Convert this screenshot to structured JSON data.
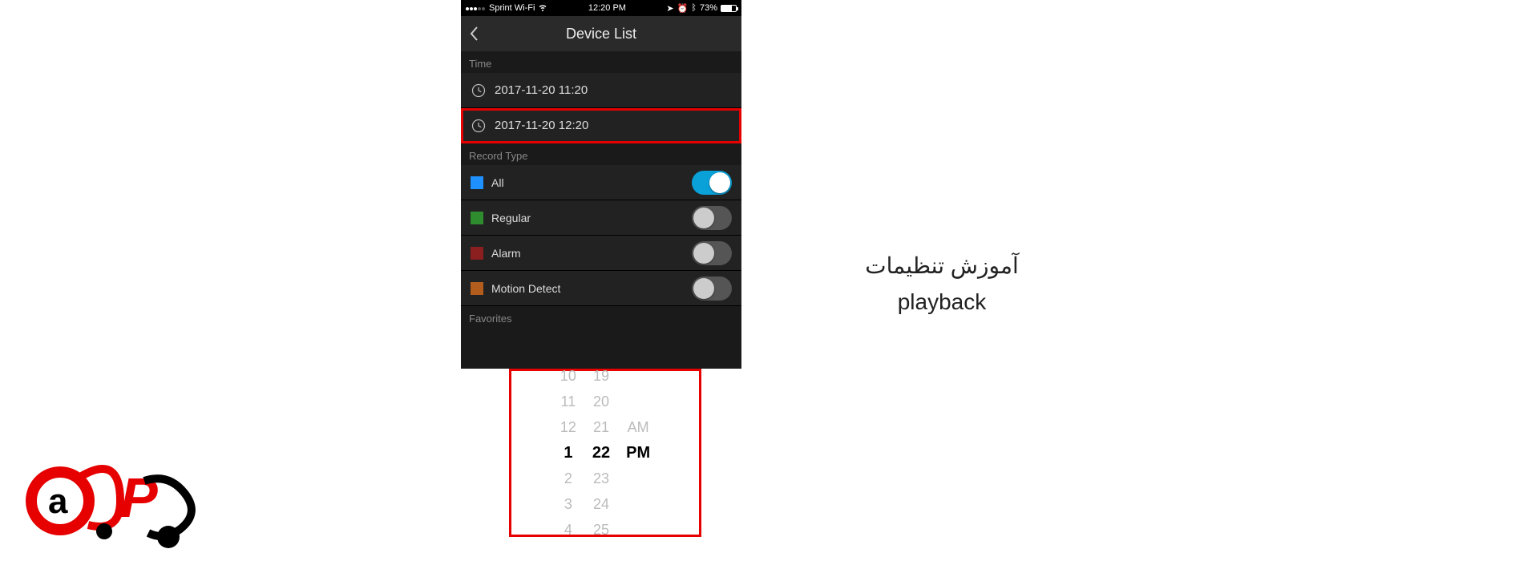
{
  "statusbar": {
    "carrier": "Sprint Wi-Fi",
    "time": "12:20 PM",
    "battery_text": "73%"
  },
  "navbar": {
    "title": "Device List"
  },
  "sections": {
    "time_label": "Time",
    "record_label": "Record Type",
    "favorites_label": "Favorites"
  },
  "time_rows": [
    {
      "text": "2017-11-20 11:20"
    },
    {
      "text": "2017-11-20 12:20"
    }
  ],
  "record_types": [
    {
      "label": "All",
      "color": "sw-blue",
      "on": true
    },
    {
      "label": "Regular",
      "color": "sw-green",
      "on": false
    },
    {
      "label": "Alarm",
      "color": "sw-red",
      "on": false
    },
    {
      "label": "Motion Detect",
      "color": "sw-orange",
      "on": false
    }
  ],
  "picker": {
    "hours": [
      "10",
      "11",
      "12",
      "1",
      "2",
      "3",
      "4"
    ],
    "minutes": [
      "19",
      "20",
      "21",
      "22",
      "23",
      "24",
      "25"
    ],
    "ampm": [
      "",
      "",
      "AM",
      "PM",
      "",
      "",
      ""
    ],
    "selected_index": 3
  },
  "caption": {
    "line1": "آموزش تنظیمات",
    "line2": "playback"
  }
}
